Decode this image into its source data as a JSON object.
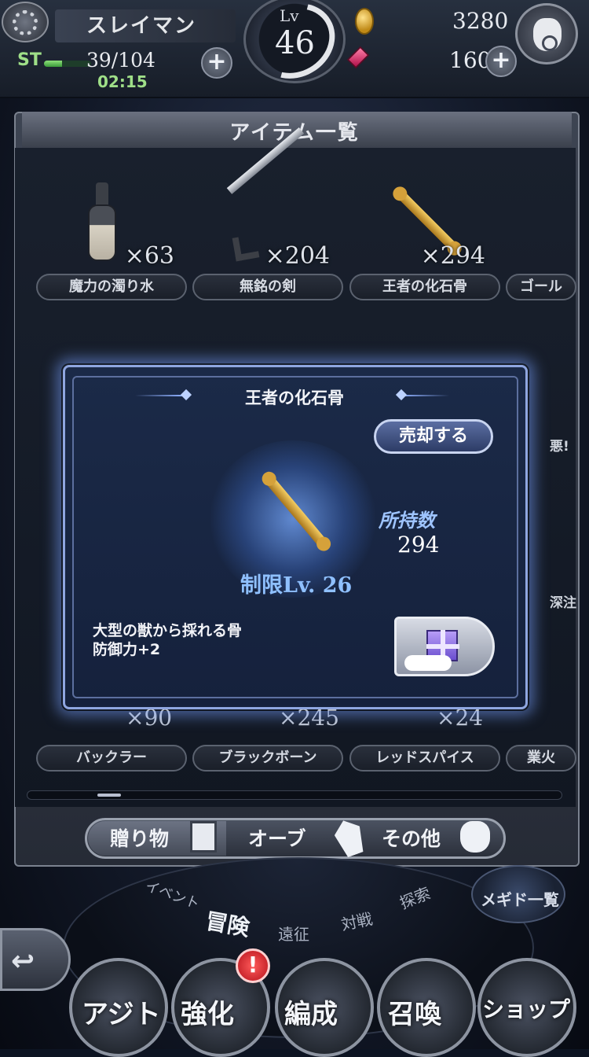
{
  "header": {
    "player_name": "スレイマン",
    "stamina_label": "ST",
    "stamina_value": "39/104",
    "stamina_ratio": 0.375,
    "stamina_timer": "02:15",
    "level_label": "Lv",
    "level_value": "46",
    "gold": "3280",
    "gems": "160",
    "plus": "+"
  },
  "panel": {
    "title": "アイテム一覧",
    "items": [
      {
        "name": "魔力の濁り水",
        "count": "×63",
        "icon": "potion-icon"
      },
      {
        "name": "無銘の剣",
        "count": "×204",
        "icon": "sword-icon"
      },
      {
        "name": "王者の化石骨",
        "count": "×294",
        "icon": "bone-icon"
      },
      {
        "name": "ゴール",
        "count": "",
        "icon": "item-icon"
      }
    ],
    "side_labels": [
      "悪!",
      "深注"
    ],
    "bottom_items": [
      {
        "name": "バックラー",
        "count": "×90"
      },
      {
        "name": "ブラックボーン",
        "count": "×245"
      },
      {
        "name": "レッドスパイス",
        "count": "×24"
      },
      {
        "name": "業火",
        "count": ""
      }
    ]
  },
  "dialog": {
    "title": "王者の化石骨",
    "sell_label": "売却する",
    "owned_label": "所持数",
    "owned_value": "294",
    "limit_level": "制限Lv. 26",
    "description_line1": "大型の獣から採れる骨",
    "description_line2": "防御力+2"
  },
  "tabs": {
    "gift": "贈り物",
    "orb": "オーブ",
    "other": "その他"
  },
  "bottom_nav": {
    "sub_event": "イベント",
    "sub_adventure": "冒険",
    "sub_expedition": "遠征",
    "sub_battle": "対戦",
    "sub_explore": "探索",
    "megido_list": "メギド一覧",
    "hideout": "アジト",
    "enhance": "強化",
    "formation": "編成",
    "summon": "召喚",
    "shop": "ショップ",
    "notify": "!",
    "back_arrow": "↩"
  },
  "colors": {
    "accent_blue": "#8fc0ff",
    "dialog_border": "#8fa6e0",
    "stamina_green": "#9fdf88"
  }
}
